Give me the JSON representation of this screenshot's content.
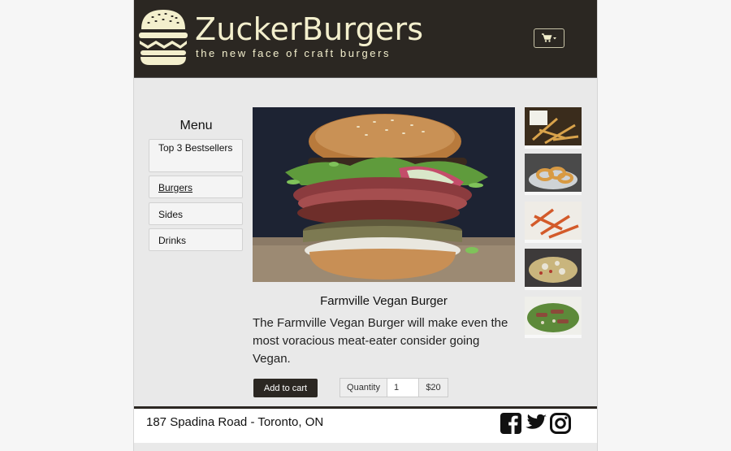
{
  "brand": {
    "name": "ZuckerBurgers",
    "tagline": "the new face of craft burgers",
    "logo_icon": "burger-logo-icon"
  },
  "header": {
    "cart_icon": "shopping-cart-icon"
  },
  "menu": {
    "title": "Menu",
    "items": [
      {
        "label": "Top 3 Bestsellers",
        "active": false
      },
      {
        "label": "Burgers",
        "active": true
      },
      {
        "label": "Sides",
        "active": false
      },
      {
        "label": "Drinks",
        "active": false
      }
    ]
  },
  "product": {
    "name": "Farmville Vegan Burger",
    "description": "The Farmville Vegan Burger will make even the most voracious meat-eater consider going Vegan.",
    "add_to_cart_label": "Add to cart",
    "quantity_label": "Quantity",
    "quantity_value": "1",
    "price": "$20"
  },
  "thumbnails": [
    "fries",
    "onion-rings",
    "sweet-potato-fries",
    "loaded-nachos",
    "steak-salad"
  ],
  "footer": {
    "address": "187 Spadina Road - Toronto, ON",
    "social": [
      "facebook-icon",
      "twitter-icon",
      "instagram-icon"
    ]
  },
  "colors": {
    "header_bg": "#2b2722",
    "brand_text": "#f3efcd",
    "page_bg": "#e9e9e9"
  }
}
